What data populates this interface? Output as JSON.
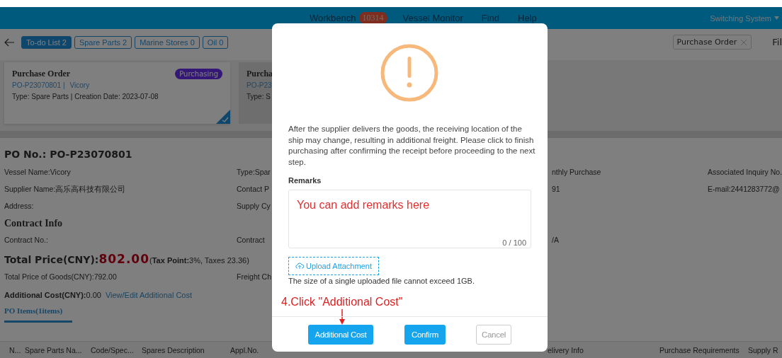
{
  "header": {
    "nav": [
      {
        "label": "Workbench",
        "badge": "10314"
      },
      {
        "label": "Vessel Monitor"
      },
      {
        "label": "Find"
      },
      {
        "label": "Help"
      }
    ],
    "switcher": "Switching System"
  },
  "toolbar": {
    "tabs": [
      {
        "label": "To-do List 2",
        "selected": true
      },
      {
        "label": "Spare Parts 2",
        "selected": false
      },
      {
        "label": "Marine Stores 0",
        "selected": false
      },
      {
        "label": "Oil 0",
        "selected": false
      }
    ],
    "filter_tag": "Purchase Order",
    "filter_link": "Fil"
  },
  "cards": [
    {
      "title": "Purchase Order",
      "status": "Purchasing",
      "number": "PO-P23070801",
      "separator": "|",
      "vessel": "Vicory",
      "meta": "Type:  Spare Parts | Creation Date:  2023-07-08",
      "selected": true
    },
    {
      "title": "Purcha",
      "number": "PO-P23",
      "meta": "Type:  S",
      "selected": false
    }
  ],
  "detail": {
    "po_no": "PO No.:  PO-P23070801",
    "info_rows": [
      [
        "Vessel Name:Vicory",
        "Type:Spar",
        "nthly Purchase",
        "Associated Inquiry No."
      ],
      [
        "Supplier Name:高乐高科技有限公司",
        "Contact P",
        "91",
        "E-mail:2441283772@"
      ],
      [
        "Address:",
        "Supply Cy",
        "",
        ""
      ]
    ],
    "contract_title": "Contract Info",
    "contract_row": [
      "Contract No.:",
      "Contract",
      "/A"
    ],
    "total_label": "Total Price(CNY):",
    "total_value": "802.00",
    "total_tax": "(**Tax Point:**3%, Taxes 23.36)",
    "goods_row": [
      "Total Price of Goods(CNY):792.00",
      "Freight Ch"
    ],
    "additional_label": "Additional Cost(CNY):",
    "additional_value": " 0.00",
    "additional_link": "View/Edit Additional Cost",
    "items_tab": "PO Items(1items)"
  },
  "table": {
    "columns": [
      "N...",
      "Spare Parts Na...",
      "Code/Spec...",
      "Spares Description",
      "Appl.No.",
      "elivery Info",
      "Purchase Requirements",
      "Supply R"
    ]
  },
  "dialog": {
    "message": "After the supplier delivers the goods, the receiving location of the ship may change, resulting in additional freight. Please click to finish purchasing after confirming the receipt before proceeding to the next step.",
    "remarks_label": "Remarks",
    "remarks_placeholder": "You can add remarks here",
    "counter": "0 / 100",
    "upload": "Upload Attachment",
    "upload_note": "The size of a single uploaded file cannot exceed 1GB.",
    "annotation": "4.Click \"Additional Cost\"",
    "buttons": [
      {
        "label": "Additional Cost",
        "kind": "primary"
      },
      {
        "label": "Confirm",
        "kind": "primary"
      },
      {
        "label": "Cancel",
        "kind": "plain"
      }
    ]
  }
}
